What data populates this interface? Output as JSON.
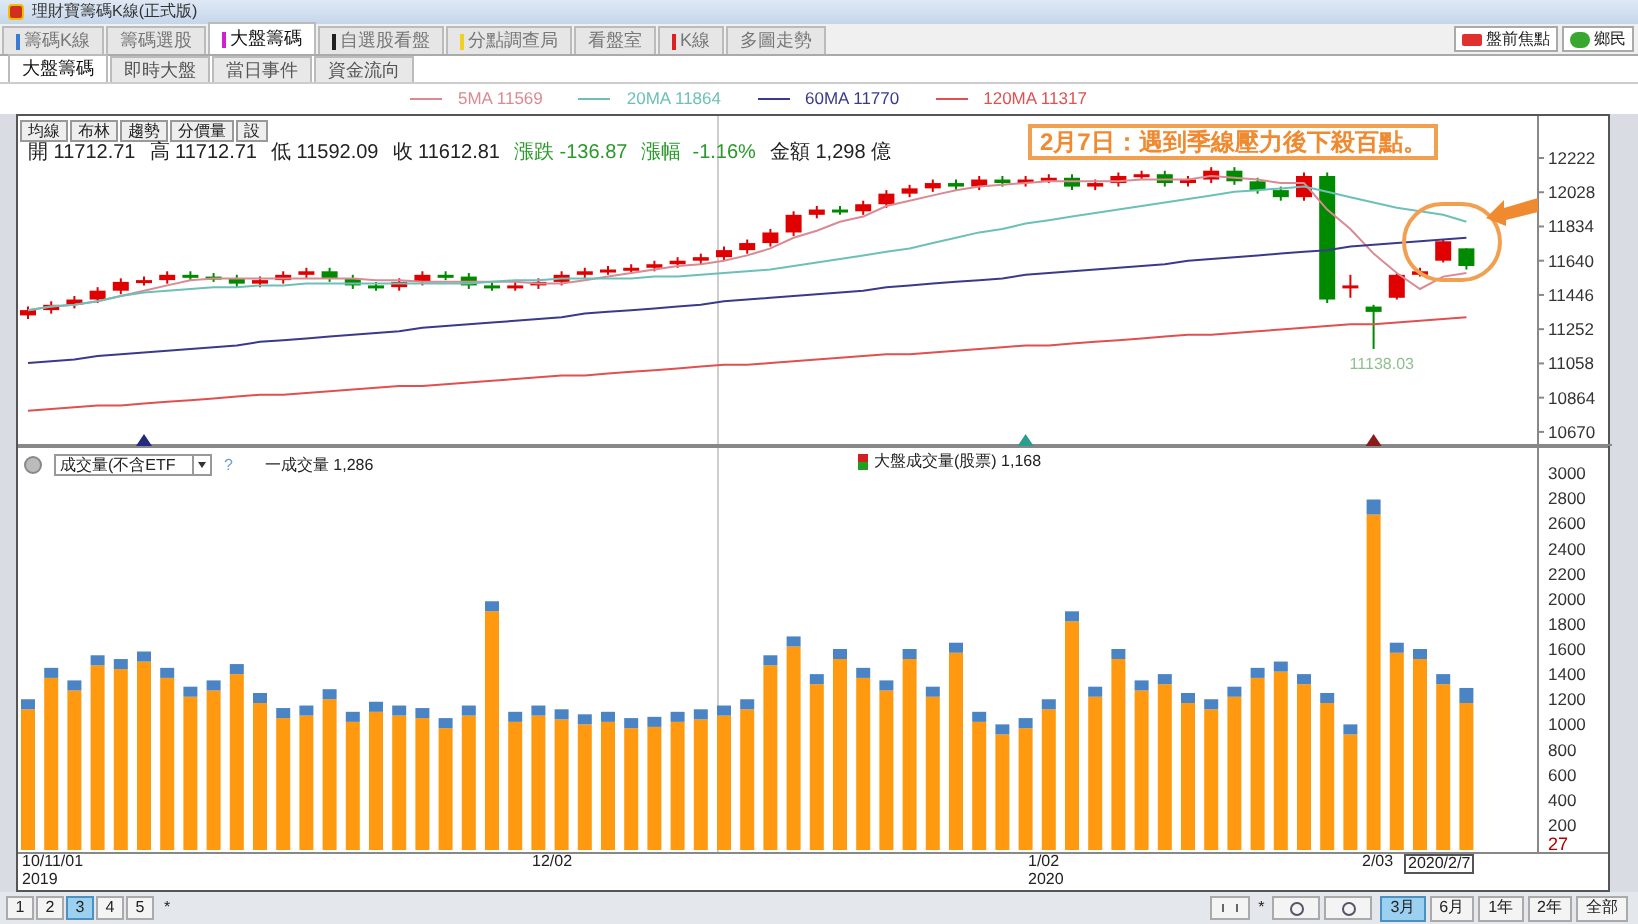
{
  "window": {
    "title": "理財寶籌碼K線(正式版)"
  },
  "tabs": [
    {
      "label": "籌碼K線",
      "selected": false,
      "color": "#3a7bd5"
    },
    {
      "label": "籌碼選股",
      "selected": false
    },
    {
      "label": "大盤籌碼",
      "selected": true,
      "color": "#d020d0"
    },
    {
      "label": "自選股看盤",
      "selected": false,
      "color": "#202020"
    },
    {
      "label": "分點調查局",
      "selected": false,
      "color": "#f0d020"
    },
    {
      "label": "看盤室",
      "selected": false
    },
    {
      "label": "K線",
      "selected": false,
      "color": "#e02020"
    },
    {
      "label": "多圖走勢",
      "selected": false
    }
  ],
  "top_right_buttons": [
    {
      "label": "盤前焦點",
      "kind": "megaphone"
    },
    {
      "label": "鄉民",
      "kind": "chat"
    }
  ],
  "sub_tabs": [
    {
      "label": "大盤籌碼",
      "selected": true
    },
    {
      "label": "即時大盤",
      "selected": false
    },
    {
      "label": "當日事件",
      "selected": false
    },
    {
      "label": "資金流向",
      "selected": false
    }
  ],
  "chart_buttons": [
    "均線",
    "布林",
    "趨勢",
    "分價量",
    "設"
  ],
  "quote": [
    {
      "text": "開 11712.71",
      "kind": "plain"
    },
    {
      "text": "高 11712.71",
      "kind": "plain"
    },
    {
      "text": "低 11592.09",
      "kind": "plain"
    },
    {
      "text": "收 11612.81",
      "kind": "plain"
    },
    {
      "text": "漲跌 -136.87",
      "kind": "down"
    },
    {
      "text": "漲幅  -1.16%",
      "kind": "down"
    },
    {
      "text": "金額 1,298 億",
      "kind": "plain"
    }
  ],
  "callout": {
    "text": "2月7日：遇到季線壓力後下殺百點。"
  },
  "price_chart": {
    "chart_data": {
      "type": "candlestick",
      "ylim": [
        10590,
        12460
      ],
      "yticks": [
        10670,
        11058,
        11446,
        11834,
        12222
      ],
      "ohlc": [
        [
          11330,
          11380,
          11310,
          11360
        ],
        [
          11360,
          11410,
          11340,
          11390
        ],
        [
          11390,
          11440,
          11370,
          11420
        ],
        [
          11420,
          11490,
          11400,
          11470
        ],
        [
          11470,
          11540,
          11450,
          11520
        ],
        [
          11520,
          11550,
          11500,
          11530
        ],
        [
          11530,
          11580,
          11510,
          11560
        ],
        [
          11560,
          11580,
          11530,
          11550
        ],
        [
          11550,
          11570,
          11520,
          11540
        ],
        [
          11540,
          11560,
          11490,
          11510
        ],
        [
          11510,
          11550,
          11490,
          11530
        ],
        [
          11530,
          11580,
          11510,
          11560
        ],
        [
          11560,
          11600,
          11540,
          11580
        ],
        [
          11580,
          11600,
          11520,
          11540
        ],
        [
          11540,
          11560,
          11480,
          11500
        ],
        [
          11500,
          11520,
          11470,
          11490
        ],
        [
          11490,
          11540,
          11470,
          11520
        ],
        [
          11520,
          11580,
          11500,
          11560
        ],
        [
          11560,
          11580,
          11530,
          11550
        ],
        [
          11550,
          11570,
          11480,
          11500
        ],
        [
          11500,
          11520,
          11470,
          11490
        ],
        [
          11490,
          11520,
          11470,
          11500
        ],
        [
          11500,
          11540,
          11480,
          11520
        ],
        [
          11520,
          11580,
          11500,
          11560
        ],
        [
          11560,
          11600,
          11540,
          11580
        ],
        [
          11580,
          11610,
          11560,
          11590
        ],
        [
          11590,
          11620,
          11570,
          11600
        ],
        [
          11600,
          11640,
          11580,
          11620
        ],
        [
          11620,
          11660,
          11600,
          11640
        ],
        [
          11640,
          11680,
          11620,
          11660
        ],
        [
          11660,
          11720,
          11640,
          11700
        ],
        [
          11700,
          11760,
          11680,
          11740
        ],
        [
          11740,
          11820,
          11720,
          11800
        ],
        [
          11800,
          11920,
          11780,
          11900
        ],
        [
          11900,
          11950,
          11880,
          11930
        ],
        [
          11930,
          11950,
          11900,
          11920
        ],
        [
          11920,
          11980,
          11900,
          11960
        ],
        [
          11960,
          12040,
          11940,
          12020
        ],
        [
          12020,
          12070,
          12000,
          12050
        ],
        [
          12050,
          12100,
          12030,
          12080
        ],
        [
          12080,
          12100,
          12040,
          12060
        ],
        [
          12060,
          12120,
          12040,
          12100
        ],
        [
          12100,
          12120,
          12060,
          12080
        ],
        [
          12080,
          12120,
          12060,
          12100
        ],
        [
          12100,
          12130,
          12080,
          12110
        ],
        [
          12110,
          12130,
          12040,
          12060
        ],
        [
          12060,
          12100,
          12040,
          12080
        ],
        [
          12080,
          12140,
          12060,
          12120
        ],
        [
          12120,
          12150,
          12100,
          12130
        ],
        [
          12130,
          12150,
          12060,
          12080
        ],
        [
          12080,
          12120,
          12060,
          12100
        ],
        [
          12100,
          12170,
          12080,
          12150
        ],
        [
          12150,
          12170,
          12070,
          12090
        ],
        [
          12090,
          12110,
          12020,
          12040
        ],
        [
          12040,
          12060,
          11980,
          12000
        ],
        [
          12000,
          12140,
          11980,
          12120
        ],
        [
          12120,
          12140,
          11400,
          11420
        ],
        [
          11490,
          11560,
          11430,
          11500
        ],
        [
          11380,
          11390,
          11140,
          11350
        ],
        [
          11430,
          11570,
          11420,
          11560
        ],
        [
          11560,
          11600,
          11550,
          11580
        ],
        [
          11640,
          11760,
          11630,
          11750
        ],
        [
          11710,
          11710,
          11590,
          11610
        ]
      ]
    },
    "ma_chart": {
      "chart_data": {
        "type": "line",
        "ylim": [
          10590,
          12460
        ],
        "yticks": [
          10864,
          11252,
          11640,
          12028
        ],
        "series": [
          {
            "name": "5MA 11569",
            "color": "#d98a92",
            "values": [
              11360,
              11380,
              11390,
              11410,
              11440,
              11470,
              11500,
              11530,
              11540,
              11540,
              11540,
              11540,
              11540,
              11540,
              11540,
              11530,
              11530,
              11520,
              11520,
              11520,
              11520,
              11520,
              11510,
              11510,
              11530,
              11550,
              11570,
              11590,
              11610,
              11620,
              11640,
              11670,
              11710,
              11770,
              11810,
              11860,
              11890,
              11950,
              11980,
              12010,
              12040,
              12060,
              12070,
              12080,
              12090,
              12090,
              12090,
              12090,
              12100,
              12100,
              12100,
              12120,
              12110,
              12100,
              12080,
              12080,
              11930,
              11820,
              11680,
              11570,
              11480,
              11550,
              11570
            ]
          },
          {
            "name": "20MA 11864",
            "color": "#6cc0b8",
            "values": [
              11360,
              11380,
              11390,
              11410,
              11440,
              11460,
              11470,
              11480,
              11490,
              11490,
              11500,
              11500,
              11510,
              11510,
              11510,
              11510,
              11510,
              11510,
              11510,
              11510,
              11520,
              11530,
              11530,
              11540,
              11540,
              11540,
              11540,
              11550,
              11550,
              11560,
              11570,
              11580,
              11590,
              11610,
              11630,
              11650,
              11670,
              11690,
              11710,
              11740,
              11770,
              11800,
              11820,
              11850,
              11870,
              11890,
              11910,
              11930,
              11950,
              11970,
              11990,
              12010,
              12030,
              12040,
              12050,
              12060,
              12030,
              12000,
              11970,
              11940,
              11920,
              11900,
              11860
            ]
          },
          {
            "name": "60MA 11770",
            "color": "#3a3a8c",
            "values": [
              11060,
              11070,
              11080,
              11100,
              11110,
              11120,
              11130,
              11140,
              11150,
              11160,
              11180,
              11190,
              11200,
              11210,
              11220,
              11230,
              11240,
              11260,
              11270,
              11280,
              11290,
              11300,
              11310,
              11320,
              11340,
              11350,
              11360,
              11370,
              11380,
              11390,
              11410,
              11420,
              11430,
              11440,
              11450,
              11460,
              11470,
              11490,
              11500,
              11510,
              11520,
              11530,
              11540,
              11560,
              11570,
              11580,
              11590,
              11600,
              11610,
              11620,
              11640,
              11650,
              11660,
              11670,
              11680,
              11690,
              11700,
              11720,
              11730,
              11740,
              11750,
              11760,
              11770
            ]
          },
          {
            "name": "120MA 11317",
            "color": "#e05050",
            "values": [
              10790,
              10800,
              10810,
              10820,
              10820,
              10830,
              10840,
              10850,
              10860,
              10870,
              10880,
              10880,
              10890,
              10900,
              10910,
              10920,
              10930,
              10930,
              10940,
              10950,
              10960,
              10970,
              10980,
              10990,
              10990,
              11000,
              11010,
              11020,
              11030,
              11040,
              11050,
              11050,
              11060,
              11070,
              11080,
              11090,
              11100,
              11110,
              11110,
              11120,
              11130,
              11140,
              11150,
              11160,
              11160,
              11170,
              11180,
              11190,
              11200,
              11210,
              11220,
              11220,
              11230,
              11240,
              11250,
              11260,
              11270,
              11280,
              11280,
              11290,
              11300,
              11310,
              11320
            ]
          }
        ]
      }
    },
    "low_label": "11138.03",
    "markers": [
      {
        "color": "#1f2a80"
      },
      {
        "color": "#2a9d8f"
      },
      {
        "color": "#8b1a1a"
      }
    ]
  },
  "volume_panel": {
    "selector": {
      "value": "成交量(不含ETF"
    },
    "help": "?",
    "chart_data": {
      "type": "bar",
      "stacked": true,
      "ylim": [
        0,
        3200
      ],
      "yticks": [
        200,
        400,
        600,
        800,
        1000,
        1200,
        1400,
        1600,
        1800,
        2000,
        2200,
        2400,
        2600,
        2800,
        3000
      ],
      "series": [
        {
          "name": "大盤成交量(股票) 1,168",
          "color": "#ff9a10",
          "values": [
            1120,
            1370,
            1270,
            1470,
            1440,
            1500,
            1370,
            1220,
            1270,
            1400,
            1170,
            1050,
            1070,
            1200,
            1020,
            1100,
            1070,
            1050,
            970,
            1070,
            1900,
            1020,
            1070,
            1040,
            1000,
            1020,
            970,
            980,
            1020,
            1040,
            1070,
            1120,
            1470,
            1620,
            1320,
            1520,
            1370,
            1270,
            1520,
            1220,
            1570,
            1020,
            920,
            970,
            1120,
            1820,
            1220,
            1520,
            1270,
            1320,
            1170,
            1120,
            1220,
            1370,
            1420,
            1320,
            1170,
            920,
            2670,
            1570,
            1520,
            1320,
            1170
          ]
        },
        {
          "name": "一成交量 1,286",
          "color": "#4a84c4",
          "values": [
            80,
            80,
            80,
            80,
            80,
            80,
            80,
            80,
            80,
            80,
            80,
            80,
            80,
            80,
            80,
            80,
            80,
            80,
            80,
            80,
            80,
            80,
            80,
            80,
            80,
            80,
            80,
            80,
            80,
            80,
            80,
            80,
            80,
            80,
            80,
            80,
            80,
            80,
            80,
            80,
            80,
            80,
            80,
            80,
            80,
            80,
            80,
            80,
            80,
            80,
            80,
            80,
            80,
            80,
            80,
            80,
            80,
            80,
            120,
            80,
            80,
            80,
            120
          ]
        }
      ]
    },
    "cursor_value": "27"
  },
  "x_axis": {
    "labels": [
      {
        "text": "10/11/01"
      },
      {
        "text": "2019"
      },
      {
        "text": "12/02"
      },
      {
        "text": "1/02"
      },
      {
        "text": "2020"
      },
      {
        "text": "2/03"
      }
    ],
    "cursor_date": "2020/2/7"
  },
  "pages": [
    {
      "label": "1",
      "selected": false
    },
    {
      "label": "2",
      "selected": false
    },
    {
      "label": "3",
      "selected": true
    },
    {
      "label": "4",
      "selected": false
    },
    {
      "label": "5",
      "selected": false
    }
  ],
  "page_more": "*",
  "range_buttons": [
    {
      "label": "3月",
      "selected": true
    },
    {
      "label": "6月",
      "selected": false
    },
    {
      "label": "1年",
      "selected": false
    },
    {
      "label": "2年",
      "selected": false
    },
    {
      "label": "全部",
      "selected": false
    }
  ],
  "toolbar_more": "*"
}
